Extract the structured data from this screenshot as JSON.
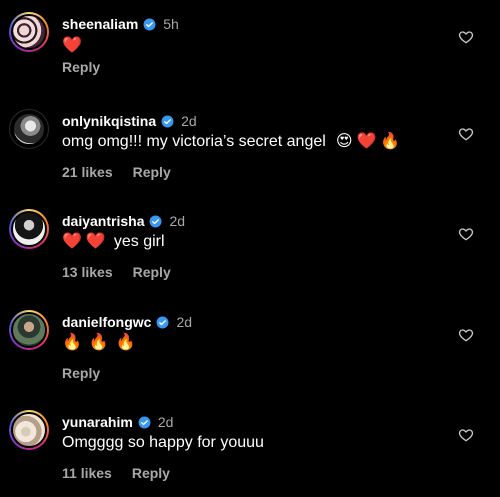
{
  "comments": [
    {
      "username": "sheenaliam",
      "verified": true,
      "time": "5h",
      "text": "",
      "emojis": [
        "❤️"
      ],
      "likes": "",
      "reply_label": "Reply"
    },
    {
      "username": "onlynikqistina",
      "verified": true,
      "time": "2d",
      "text": "omg omg!!! my victoria’s secret angel",
      "emojis": [
        "😍",
        "❤️",
        "🔥"
      ],
      "likes": "21 likes",
      "reply_label": "Reply"
    },
    {
      "username": "daiyantrisha",
      "verified": true,
      "time": "2d",
      "text": "yes girl",
      "emojis": [
        "❤️",
        "❤️"
      ],
      "likes": "13 likes",
      "reply_label": "Reply"
    },
    {
      "username": "danielfongwc",
      "verified": true,
      "time": "2d",
      "text": "",
      "emojis": [
        "🔥",
        "🔥",
        "🔥"
      ],
      "likes": "",
      "reply_label": "Reply"
    },
    {
      "username": "yunarahim",
      "verified": true,
      "time": "2d",
      "text": "Omgggg so happy for youuu",
      "emojis": [],
      "likes": "11 likes",
      "reply_label": "Reply"
    }
  ],
  "icons": {
    "verified": "verified-badge-icon",
    "like": "heart-outline-icon"
  },
  "colors": {
    "background": "#000000",
    "text": "#ffffff",
    "muted": "#a8a8a8",
    "verified": "#3897f0",
    "heart": "#ff2d3c"
  }
}
